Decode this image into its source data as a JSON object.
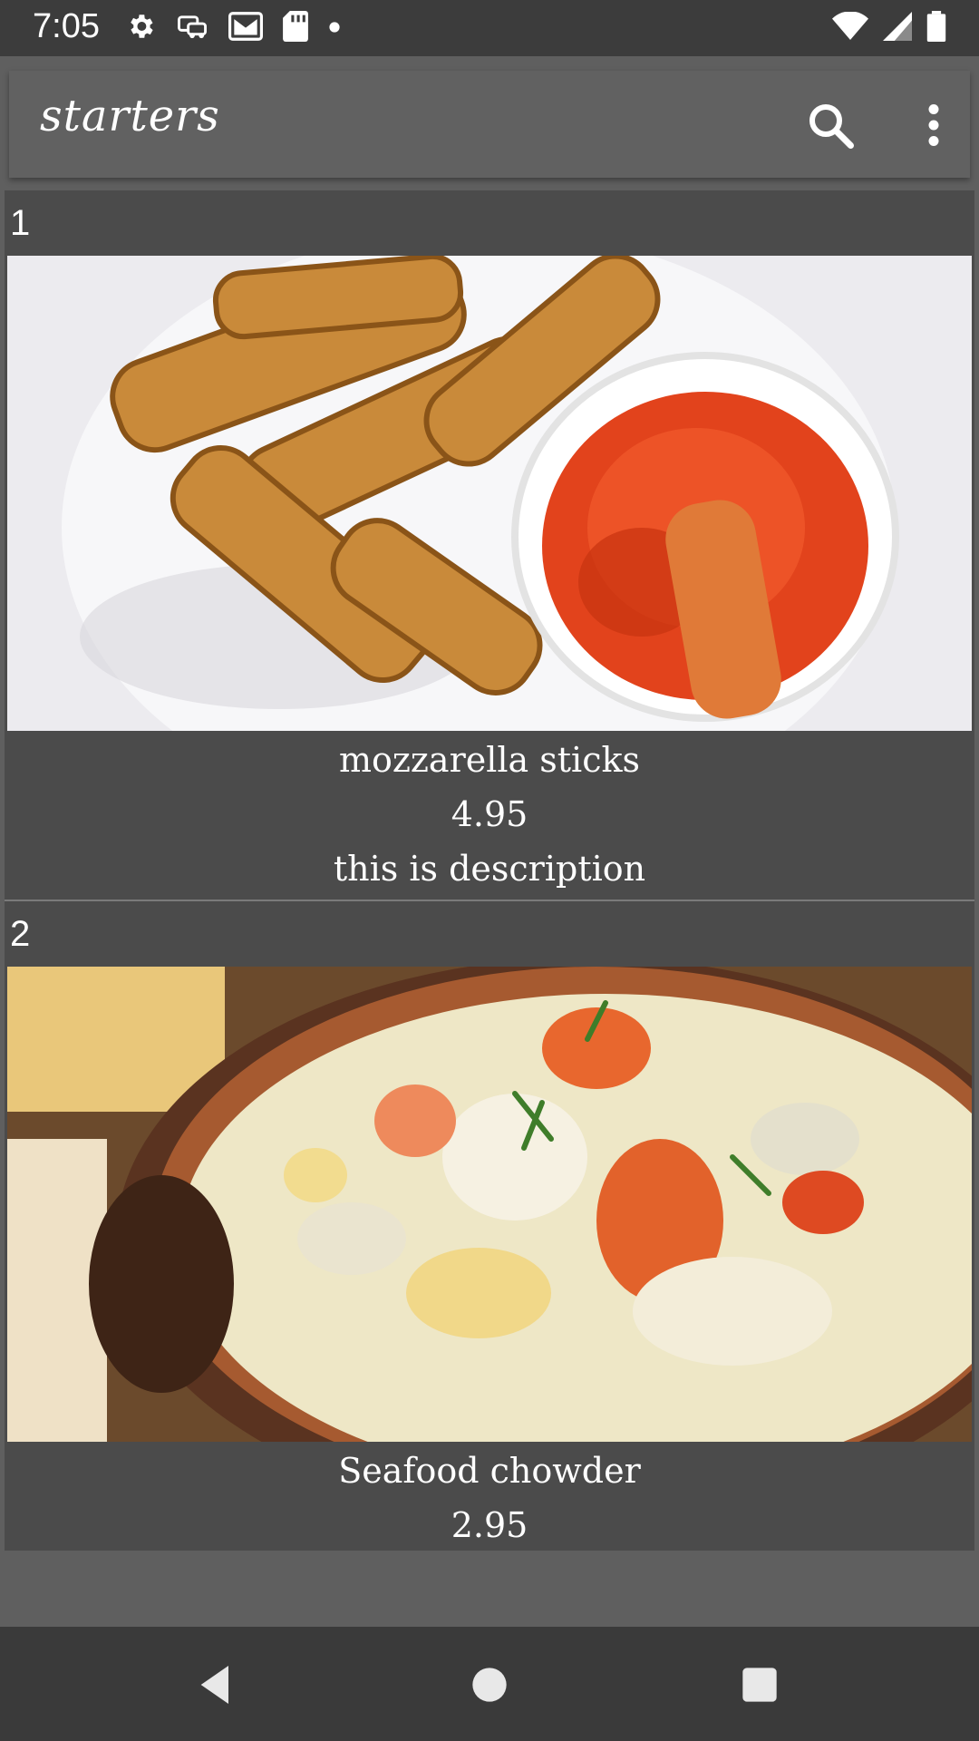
{
  "status_bar": {
    "time": "7:05",
    "left_icons": [
      "settings-icon",
      "car-icon",
      "gmail-icon",
      "sd-card-icon",
      "dot-icon"
    ],
    "right_icons": [
      "wifi-icon",
      "signal-icon",
      "battery-icon"
    ]
  },
  "toolbar": {
    "title": "starters",
    "actions": [
      "search-icon",
      "more-vert-icon"
    ]
  },
  "menu_items": [
    {
      "number": "1",
      "name": "mozzarella sticks",
      "price": "4.95",
      "description": "this is description"
    },
    {
      "number": "2",
      "name": "Seafood chowder",
      "price": "2.95",
      "description": ""
    }
  ],
  "nav_bar": [
    "back-icon",
    "home-icon",
    "recents-icon"
  ],
  "colors": {
    "background": "#5f5f5f",
    "status_bar": "#3c3c3c",
    "toolbar": "#616161",
    "card": "#4b4b4b",
    "nav_bar": "#3a3a3a"
  }
}
